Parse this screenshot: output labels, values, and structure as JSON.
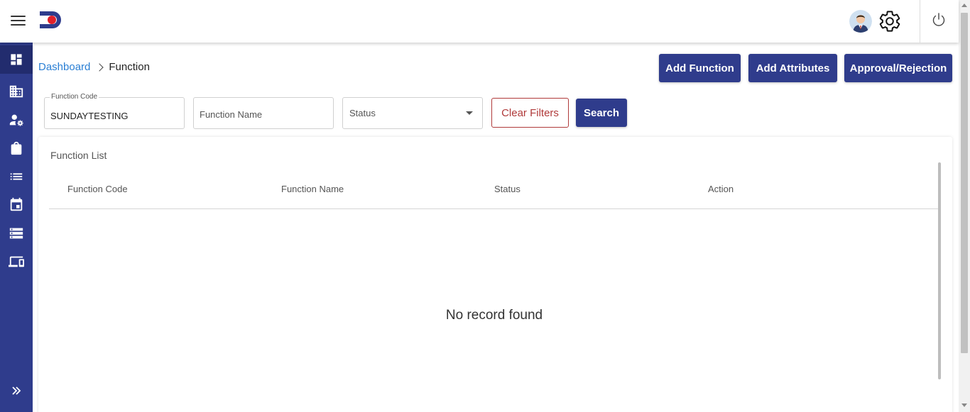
{
  "header": {
    "menu_icon": "hamburger-icon",
    "logo": "app-logo",
    "avatar": "user-avatar",
    "settings_icon": "gear-icon",
    "power_icon": "power-icon"
  },
  "sidebar": {
    "items": [
      {
        "icon": "dashboard-icon",
        "active": true
      },
      {
        "icon": "building-icon"
      },
      {
        "icon": "user-settings-icon"
      },
      {
        "icon": "shopping-bag-icon"
      },
      {
        "icon": "list-icon"
      },
      {
        "icon": "calendar-icon"
      },
      {
        "icon": "storage-icon"
      },
      {
        "icon": "devices-icon"
      }
    ],
    "expand_icon": "double-chevron-right-icon"
  },
  "breadcrumb": {
    "root": "Dashboard",
    "current": "Function"
  },
  "actions": {
    "add_function": "Add Function",
    "add_attributes": "Add Attributes",
    "approval_rejection": "Approval/Rejection"
  },
  "filters": {
    "function_code": {
      "label": "Function Code",
      "value": "SUNDAYTESTING"
    },
    "function_name": {
      "placeholder": "Function Name",
      "value": ""
    },
    "status": {
      "placeholder": "Status"
    },
    "clear_label": "Clear Filters",
    "search_label": "Search"
  },
  "table": {
    "title": "Function List",
    "columns": [
      "Function Code",
      "Function Name",
      "Status",
      "Action"
    ],
    "rows": [],
    "empty_message": "No record found"
  },
  "colors": {
    "primary": "#2f3c8c",
    "sidebar_active": "#222c6e",
    "link": "#2a7fd4",
    "danger": "#b03a3a",
    "logo_red": "#e0202a"
  }
}
